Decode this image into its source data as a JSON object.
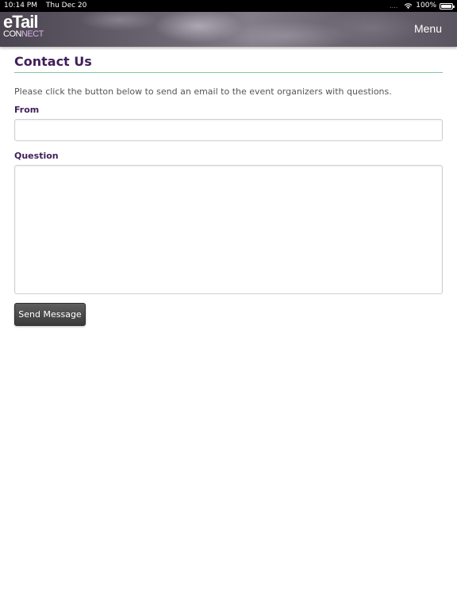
{
  "status_bar": {
    "time": "10:14 PM",
    "date": "Thu Dec 20",
    "signal": "....",
    "battery_percent": "100%",
    "battery_level": 1.0,
    "icons": [
      "wifi-icon",
      "battery-icon"
    ]
  },
  "header": {
    "logo_main": "eTail",
    "logo_sub_part1": "CON",
    "logo_sub_part2": "NECT",
    "menu_label": "Menu"
  },
  "main": {
    "title": "Contact Us",
    "intro": "Please click the button below to send an email to the event organizers with questions.",
    "from_label": "From",
    "from_value": "",
    "question_label": "Question",
    "question_value": "",
    "send_label": "Send Message"
  },
  "colors": {
    "title": "#3f1f5a",
    "divider": "#7fc79a",
    "button": "#3a3a3a"
  }
}
